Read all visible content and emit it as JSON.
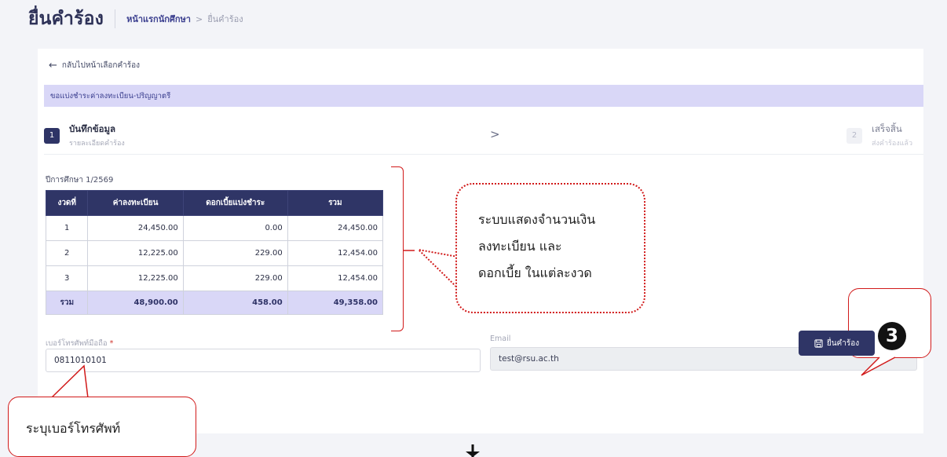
{
  "header": {
    "title": "ยื่นคำร้อง",
    "breadcrumb_home": "หน้าแรกนักศึกษา",
    "breadcrumb_separator": ">",
    "breadcrumb_current": "ยื่นคำร้อง"
  },
  "back_link": {
    "arrow": "←",
    "label": "กลับไปหน้าเลือกคำร้อง"
  },
  "form_title": "ขอแบ่งชำระค่าลงทะเบียน-ปริญญาตรี",
  "stepper": {
    "steps": [
      {
        "number": "1",
        "title": "บันทึกข้อมูล",
        "subtitle": "รายละเอียดคำร้อง",
        "state": "active"
      },
      {
        "number": "2",
        "title": "เสร็จสิ้น",
        "subtitle": "ส่งคำร้องแล้ว",
        "state": "pending"
      }
    ],
    "chevron": ">"
  },
  "academic_year_label": "ปีการศึกษา 1/2569",
  "fee_table": {
    "headers": [
      "งวดที่",
      "ค่าลงทะเบียน",
      "ดอกเบี้ยแบ่งชำระ",
      "รวม"
    ],
    "rows": [
      [
        "1",
        "24,450.00",
        "0.00",
        "24,450.00"
      ],
      [
        "2",
        "12,225.00",
        "229.00",
        "12,454.00"
      ],
      [
        "3",
        "12,225.00",
        "229.00",
        "12,454.00"
      ]
    ],
    "total_row": [
      "รวม",
      "48,900.00",
      "458.00",
      "49,358.00"
    ]
  },
  "phone_field": {
    "label": "เบอร์โทรศัพท์มือถือ",
    "required_mark": "*",
    "value": "0811010101"
  },
  "email_field": {
    "label": "Email",
    "value": "test@rsu.ac.th"
  },
  "submit_button": {
    "icon": "save-icon",
    "label": "ยื่นคำร้อง"
  },
  "annotations": {
    "bubble_lines": [
      "ระบบแสดงจำนวนเงิน",
      "ลงทะเบียน และ",
      "ดอกเบี้ย ในแต่ละงวด"
    ],
    "phone_callout": "ระบุเบอร์โทรศัพท์",
    "step_badge": "3",
    "down_arrow": "down-arrow-icon"
  },
  "colors": {
    "primary": "#2f3566",
    "banner": "#d9d7f7",
    "annotation_red": "#d11a1a"
  }
}
